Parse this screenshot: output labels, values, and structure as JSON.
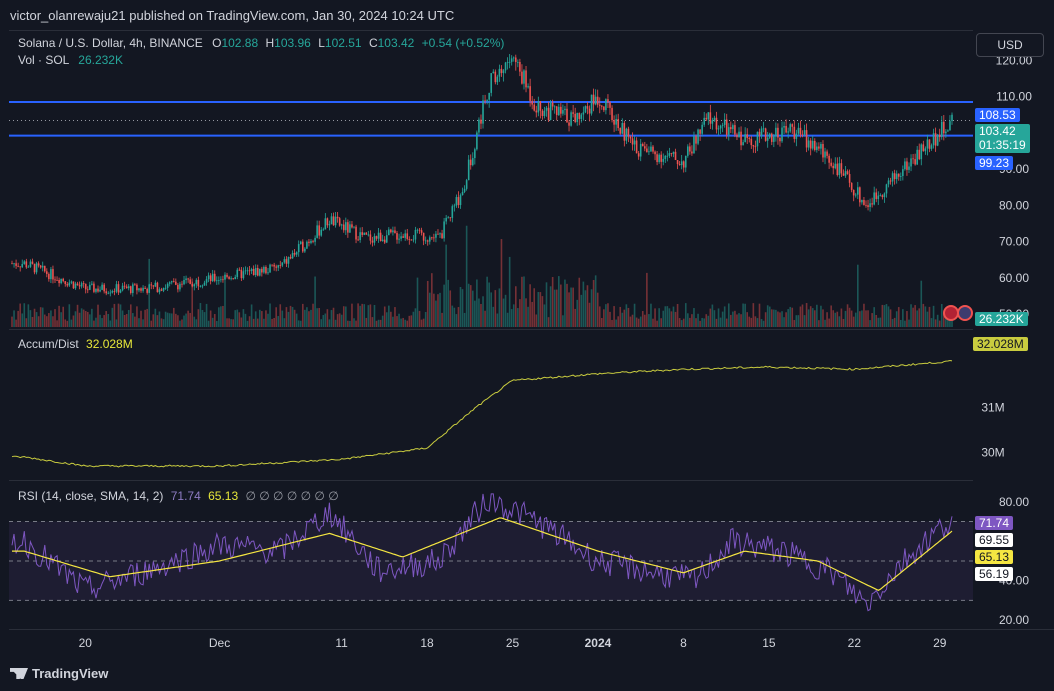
{
  "publisher_line": "victor_olanrewaju21 published on TradingView.com, Jan 30, 2024 10:24 UTC",
  "header": {
    "symbol": "Solana / U.S. Dollar, 4h, BINANCE",
    "o_label": "O",
    "o_value": "102.88",
    "h_label": "H",
    "h_value": "103.96",
    "l_label": "L",
    "l_value": "102.51",
    "c_label": "C",
    "c_value": "103.42",
    "change": "+0.54 (+0.52%)",
    "vol_label": "Vol · SOL",
    "vol_value": "26.232K"
  },
  "currency_button": "USD",
  "accum_header": {
    "label": "Accum/Dist",
    "value": "32.028M"
  },
  "rsi_header": {
    "label": "RSI (14, close, SMA, 14, 2)",
    "rsi": "71.74",
    "sma": "65.13",
    "extras": "∅ ∅ ∅ ∅ ∅ ∅ ∅"
  },
  "price_tags": {
    "upper": "108.53",
    "last": "103.42",
    "countdown": "01:35:19",
    "lower": "99.23",
    "volume": "26.232K",
    "accum": "32.028M",
    "rsi": "71.74",
    "rsi_b": "69.55",
    "rsi_sma": "65.13",
    "rsi_d": "56.19"
  },
  "footer_brand": "TradingView",
  "colors": {
    "up": "#26a69a",
    "down": "#ef5350",
    "level_line": "#2962ff",
    "accum_line": "#c9cc3f",
    "rsi_line": "#7e57c2",
    "rsi_sma": "#f5e642",
    "background": "#131722"
  },
  "chart_data": [
    {
      "type": "candlestick",
      "title": "Solana / U.S. Dollar, 4h, BINANCE",
      "ylim": [
        47,
        127
      ],
      "y_ticks": [
        "120.00",
        "110.00",
        "90.00",
        "80.00",
        "70.00",
        "60.00",
        "50.00"
      ],
      "x_ticks": [
        "20",
        "Dec",
        "11",
        "18",
        "25",
        "2024",
        "8",
        "15",
        "22",
        "29"
      ],
      "horizontal_levels": [
        108.53,
        99.23
      ],
      "key_points": [
        {
          "x": "Nov 15",
          "y": 64
        },
        {
          "x": "Nov 20",
          "y": 57
        },
        {
          "x": "Nov 25",
          "y": 57
        },
        {
          "x": "Dec 1",
          "y": 60
        },
        {
          "x": "Dec 6",
          "y": 63
        },
        {
          "x": "Dec 10",
          "y": 76
        },
        {
          "x": "Dec 13",
          "y": 71
        },
        {
          "x": "Dec 16",
          "y": 72
        },
        {
          "x": "Dec 19",
          "y": 71
        },
        {
          "x": "Dec 21",
          "y": 85
        },
        {
          "x": "Dec 23",
          "y": 113
        },
        {
          "x": "Dec 25",
          "y": 121
        },
        {
          "x": "Dec 27",
          "y": 107
        },
        {
          "x": "Dec 30",
          "y": 104
        },
        {
          "x": "Jan 1",
          "y": 110
        },
        {
          "x": "Jan 4",
          "y": 96
        },
        {
          "x": "Jan 8",
          "y": 92
        },
        {
          "x": "Jan 10",
          "y": 104
        },
        {
          "x": "Jan 13",
          "y": 98
        },
        {
          "x": "Jan 17",
          "y": 101
        },
        {
          "x": "Jan 20",
          "y": 93
        },
        {
          "x": "Jan 23",
          "y": 80
        },
        {
          "x": "Jan 26",
          "y": 90
        },
        {
          "x": "Jan 30",
          "y": 103.42
        }
      ],
      "volume_last": "26.232K"
    },
    {
      "type": "line",
      "name": "Accum/Dist",
      "y_ticks": [
        "31M",
        "30M"
      ],
      "ylim": [
        29.5,
        32.5
      ],
      "key_points": [
        {
          "x": "Nov 15",
          "y": 29.9
        },
        {
          "x": "Nov 20",
          "y": 29.7
        },
        {
          "x": "Dec 1",
          "y": 29.7
        },
        {
          "x": "Dec 11",
          "y": 29.85
        },
        {
          "x": "Dec 18",
          "y": 30.1
        },
        {
          "x": "Dec 22",
          "y": 31.0
        },
        {
          "x": "Dec 25",
          "y": 31.6
        },
        {
          "x": "Jan 1",
          "y": 31.75
        },
        {
          "x": "Jan 8",
          "y": 31.85
        },
        {
          "x": "Jan 15",
          "y": 31.9
        },
        {
          "x": "Jan 22",
          "y": 31.85
        },
        {
          "x": "Jan 30",
          "y": 32.028
        }
      ]
    },
    {
      "type": "line",
      "name": "RSI (14, close, SMA, 14, 2)",
      "y_ticks": [
        "80.00",
        "40.00",
        "20.00"
      ],
      "ylim": [
        16,
        86
      ],
      "bands": [
        70,
        50,
        30
      ],
      "series": [
        {
          "name": "RSI",
          "key_points": [
            {
              "x": "Nov 15",
              "y": 60
            },
            {
              "x": "Nov 20",
              "y": 35
            },
            {
              "x": "Nov 25",
              "y": 45
            },
            {
              "x": "Dec 1",
              "y": 58
            },
            {
              "x": "Dec 6",
              "y": 55
            },
            {
              "x": "Dec 10",
              "y": 75
            },
            {
              "x": "Dec 14",
              "y": 45
            },
            {
              "x": "Dec 19",
              "y": 50
            },
            {
              "x": "Dec 23",
              "y": 82
            },
            {
              "x": "Dec 27",
              "y": 70
            },
            {
              "x": "Jan 1",
              "y": 50
            },
            {
              "x": "Jan 5",
              "y": 45
            },
            {
              "x": "Jan 9",
              "y": 40
            },
            {
              "x": "Jan 12",
              "y": 60
            },
            {
              "x": "Jan 16",
              "y": 55
            },
            {
              "x": "Jan 20",
              "y": 45
            },
            {
              "x": "Jan 23",
              "y": 28
            },
            {
              "x": "Jan 26",
              "y": 50
            },
            {
              "x": "Jan 30",
              "y": 71.74
            }
          ]
        },
        {
          "name": "SMA",
          "key_points": [
            {
              "x": "Nov 15",
              "y": 55
            },
            {
              "x": "Nov 22",
              "y": 42
            },
            {
              "x": "Dec 1",
              "y": 50
            },
            {
              "x": "Dec 10",
              "y": 64
            },
            {
              "x": "Dec 16",
              "y": 52
            },
            {
              "x": "Dec 24",
              "y": 72
            },
            {
              "x": "Jan 1",
              "y": 55
            },
            {
              "x": "Jan 8",
              "y": 44
            },
            {
              "x": "Jan 13",
              "y": 55
            },
            {
              "x": "Jan 19",
              "y": 50
            },
            {
              "x": "Jan 24",
              "y": 35
            },
            {
              "x": "Jan 30",
              "y": 65.13
            }
          ]
        }
      ]
    }
  ]
}
